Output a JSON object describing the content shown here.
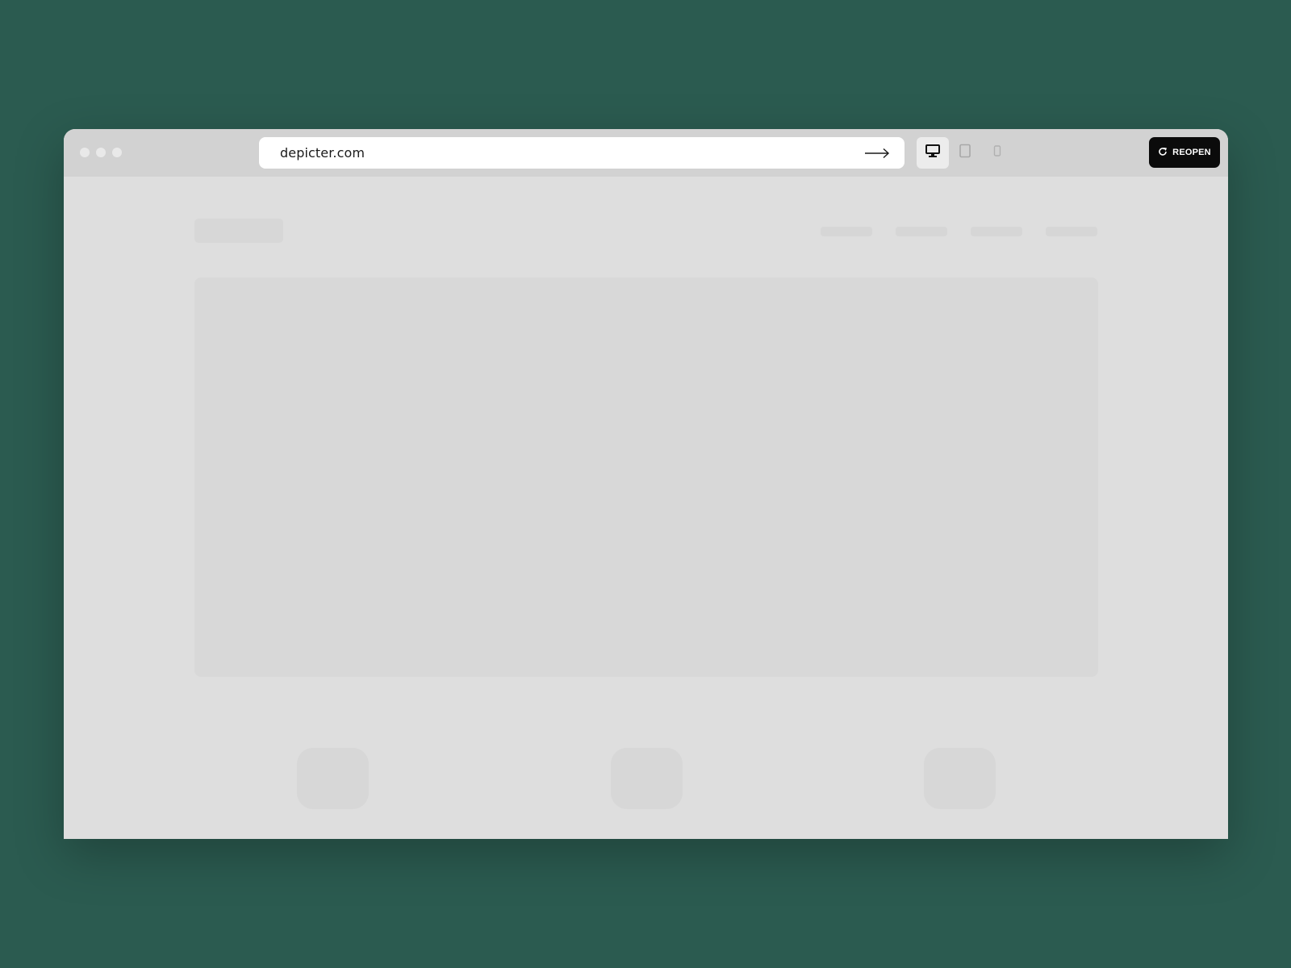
{
  "browser": {
    "url": "depicter.com",
    "reopen_label": "REOPEN",
    "devices": [
      {
        "name": "desktop",
        "icon": "monitor-icon",
        "active": true
      },
      {
        "name": "tablet",
        "icon": "tablet-icon",
        "active": false
      },
      {
        "name": "mobile",
        "icon": "phone-icon",
        "active": false
      }
    ]
  },
  "colors": {
    "background": "#2b5b50",
    "toolbar": "#d2d2d2",
    "page": "#dedede",
    "skeleton": "#d7d7d7",
    "reopen_button": "#0b0b0b"
  }
}
